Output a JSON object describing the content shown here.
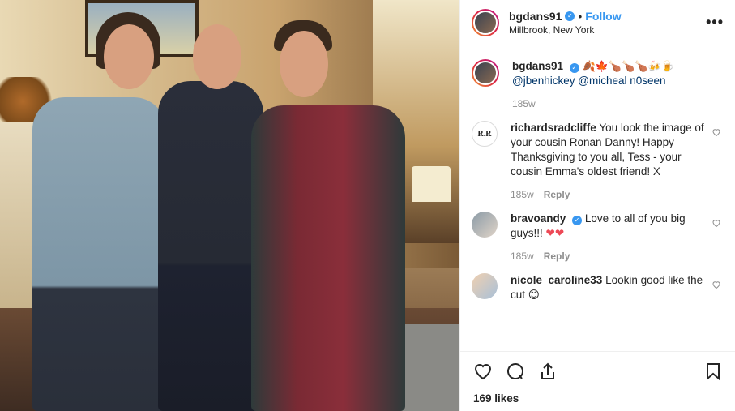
{
  "post": {
    "username": "bgdans91",
    "follow_label": "Follow",
    "separator": "•",
    "location": "Millbrook, New York",
    "more_label": "•••"
  },
  "caption": {
    "username": "bgdans91",
    "emoji": "🍂🍁🍗🍗🍗🍻🍺",
    "mention1": "@jbenhickey",
    "mention2": "@micheal n0seen",
    "time": "185w"
  },
  "comments": [
    {
      "username": "richardsradcliffe",
      "avatar_text": "R.R",
      "text": "You look the image of your cousin Ronan Danny! Happy Thanksgiving to you all, Tess - your cousin Emma's oldest friend! X",
      "time": "185w",
      "reply": "Reply"
    },
    {
      "username": "bravoandy",
      "text": "Love to all of you big guys!!!",
      "hearts": "❤❤",
      "time": "185w",
      "reply": "Reply"
    },
    {
      "username": "nicole_caroline33",
      "text": "Lookin good like the cut",
      "emoji": "😊"
    }
  ],
  "likes": "169 likes",
  "icons": [
    "heart-icon",
    "comment-icon",
    "share-icon",
    "bookmark-icon",
    "verified-badge-icon",
    "more-icon"
  ],
  "colors": {
    "link": "#3897f0",
    "mention": "#003569",
    "muted": "#8e8e8e",
    "border": "#efefef"
  }
}
